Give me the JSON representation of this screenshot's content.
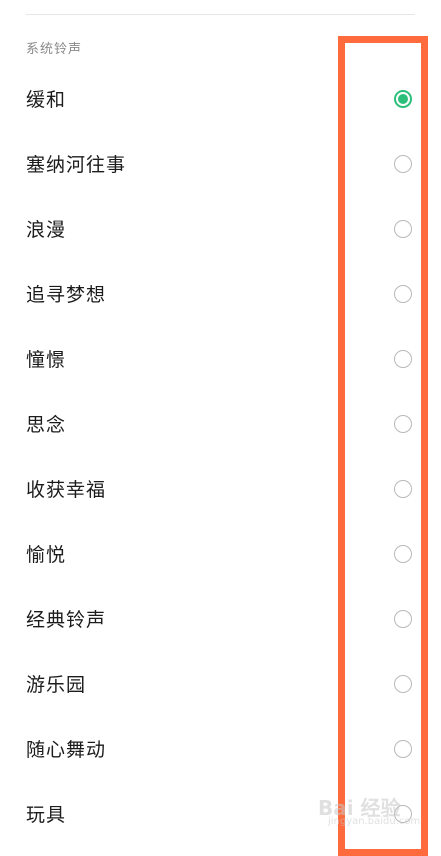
{
  "section": {
    "title": "系统铃声"
  },
  "ringtones": [
    {
      "label": "缓和",
      "selected": true
    },
    {
      "label": "塞纳河往事",
      "selected": false
    },
    {
      "label": "浪漫",
      "selected": false
    },
    {
      "label": "追寻梦想",
      "selected": false
    },
    {
      "label": "憧憬",
      "selected": false
    },
    {
      "label": "思念",
      "selected": false
    },
    {
      "label": "收获幸福",
      "selected": false
    },
    {
      "label": "愉悦",
      "selected": false
    },
    {
      "label": "经典铃声",
      "selected": false
    },
    {
      "label": "游乐园",
      "selected": false
    },
    {
      "label": "随心舞动",
      "selected": false
    },
    {
      "label": "玩具",
      "selected": false
    }
  ],
  "colors": {
    "accent": "#2bbf7a",
    "highlight": "#ff6b3d"
  },
  "watermark": {
    "text": "Bai 经验",
    "sub": "jingyan.baidu.com"
  }
}
